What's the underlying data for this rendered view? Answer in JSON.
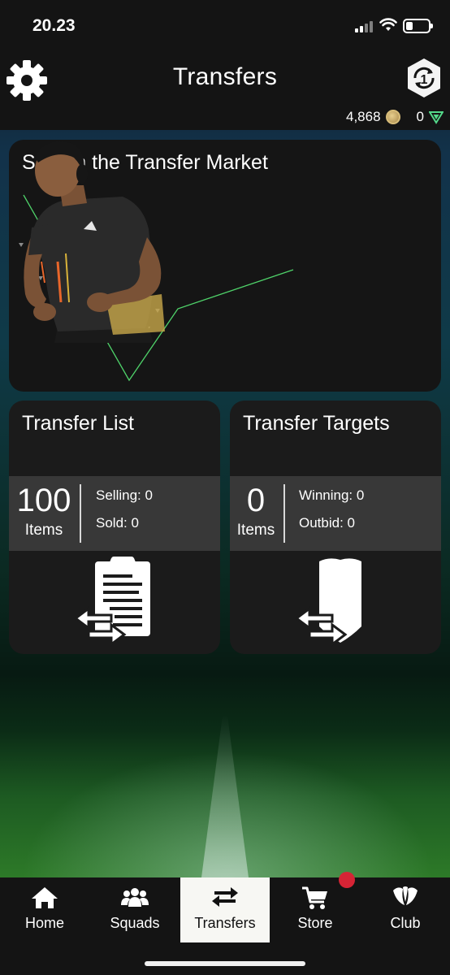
{
  "status_bar": {
    "time": "20.23"
  },
  "header": {
    "title": "Transfers",
    "coins": "4,868",
    "points": "0",
    "objectives_badge": "1"
  },
  "market_card": {
    "title": "Search the Transfer Market"
  },
  "transfer_list": {
    "title": "Transfer List",
    "count": "100",
    "count_unit": "Items",
    "selling": "Selling: 0",
    "sold": "Sold: 0"
  },
  "transfer_targets": {
    "title": "Transfer Targets",
    "count": "0",
    "count_unit": "Items",
    "winning": "Winning: 0",
    "outbid": "Outbid: 0"
  },
  "tabs": [
    {
      "label": "Home",
      "icon": "home-icon"
    },
    {
      "label": "Squads",
      "icon": "squads-icon"
    },
    {
      "label": "Transfers",
      "icon": "transfers-icon",
      "active": true
    },
    {
      "label": "Store",
      "icon": "cart-icon",
      "has_notification": true
    },
    {
      "label": "Club",
      "icon": "club-icon"
    }
  ],
  "colors": {
    "accent_green": "#4fd36a",
    "notification_red": "#d62435",
    "card_bg": "#1b1b1b",
    "stats_bg": "#383838",
    "active_tab_bg": "#f7f7f3"
  }
}
